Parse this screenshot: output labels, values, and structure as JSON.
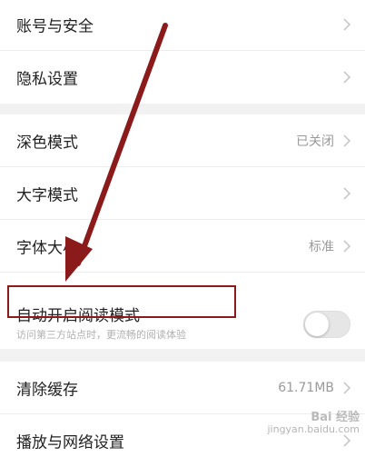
{
  "settings": {
    "group1": [
      {
        "label": "账号与安全"
      },
      {
        "label": "隐私设置"
      }
    ],
    "group2": [
      {
        "label": "深色模式",
        "value": "已关闭"
      },
      {
        "label": "大字模式",
        "value": ""
      },
      {
        "label": "字体大小",
        "value": "标准"
      }
    ],
    "reading_mode": {
      "label": "自动开启阅读模式",
      "hint": "访问第三方站点时，更流畅的阅读体验",
      "enabled": false
    },
    "group3": [
      {
        "label": "清除缓存",
        "value": "61.71MB"
      },
      {
        "label": "播放与网络设置",
        "value": ""
      }
    ]
  },
  "watermark": {
    "brand": "Bai 经验",
    "domain": "jingyan.baidu.com"
  },
  "colors": {
    "annotation": "#8b1a1a",
    "background": "#f2f2f2",
    "text_primary": "#222222",
    "text_secondary": "#9a9a9a"
  }
}
